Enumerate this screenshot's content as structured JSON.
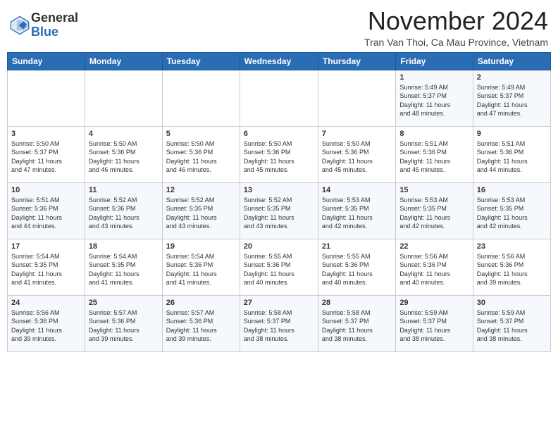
{
  "header": {
    "logo_line1": "General",
    "logo_line2": "Blue",
    "month": "November 2024",
    "location": "Tran Van Thoi, Ca Mau Province, Vietnam"
  },
  "weekdays": [
    "Sunday",
    "Monday",
    "Tuesday",
    "Wednesday",
    "Thursday",
    "Friday",
    "Saturday"
  ],
  "weeks": [
    [
      {
        "day": "",
        "info": ""
      },
      {
        "day": "",
        "info": ""
      },
      {
        "day": "",
        "info": ""
      },
      {
        "day": "",
        "info": ""
      },
      {
        "day": "",
        "info": ""
      },
      {
        "day": "1",
        "info": "Sunrise: 5:49 AM\nSunset: 5:37 PM\nDaylight: 11 hours\nand 48 minutes."
      },
      {
        "day": "2",
        "info": "Sunrise: 5:49 AM\nSunset: 5:37 PM\nDaylight: 11 hours\nand 47 minutes."
      }
    ],
    [
      {
        "day": "3",
        "info": "Sunrise: 5:50 AM\nSunset: 5:37 PM\nDaylight: 11 hours\nand 47 minutes."
      },
      {
        "day": "4",
        "info": "Sunrise: 5:50 AM\nSunset: 5:36 PM\nDaylight: 11 hours\nand 46 minutes."
      },
      {
        "day": "5",
        "info": "Sunrise: 5:50 AM\nSunset: 5:36 PM\nDaylight: 11 hours\nand 46 minutes."
      },
      {
        "day": "6",
        "info": "Sunrise: 5:50 AM\nSunset: 5:36 PM\nDaylight: 11 hours\nand 45 minutes."
      },
      {
        "day": "7",
        "info": "Sunrise: 5:50 AM\nSunset: 5:36 PM\nDaylight: 11 hours\nand 45 minutes."
      },
      {
        "day": "8",
        "info": "Sunrise: 5:51 AM\nSunset: 5:36 PM\nDaylight: 11 hours\nand 45 minutes."
      },
      {
        "day": "9",
        "info": "Sunrise: 5:51 AM\nSunset: 5:36 PM\nDaylight: 11 hours\nand 44 minutes."
      }
    ],
    [
      {
        "day": "10",
        "info": "Sunrise: 5:51 AM\nSunset: 5:36 PM\nDaylight: 11 hours\nand 44 minutes."
      },
      {
        "day": "11",
        "info": "Sunrise: 5:52 AM\nSunset: 5:36 PM\nDaylight: 11 hours\nand 43 minutes."
      },
      {
        "day": "12",
        "info": "Sunrise: 5:52 AM\nSunset: 5:35 PM\nDaylight: 11 hours\nand 43 minutes."
      },
      {
        "day": "13",
        "info": "Sunrise: 5:52 AM\nSunset: 5:35 PM\nDaylight: 11 hours\nand 43 minutes."
      },
      {
        "day": "14",
        "info": "Sunrise: 5:53 AM\nSunset: 5:35 PM\nDaylight: 11 hours\nand 42 minutes."
      },
      {
        "day": "15",
        "info": "Sunrise: 5:53 AM\nSunset: 5:35 PM\nDaylight: 11 hours\nand 42 minutes."
      },
      {
        "day": "16",
        "info": "Sunrise: 5:53 AM\nSunset: 5:35 PM\nDaylight: 11 hours\nand 42 minutes."
      }
    ],
    [
      {
        "day": "17",
        "info": "Sunrise: 5:54 AM\nSunset: 5:35 PM\nDaylight: 11 hours\nand 41 minutes."
      },
      {
        "day": "18",
        "info": "Sunrise: 5:54 AM\nSunset: 5:35 PM\nDaylight: 11 hours\nand 41 minutes."
      },
      {
        "day": "19",
        "info": "Sunrise: 5:54 AM\nSunset: 5:36 PM\nDaylight: 11 hours\nand 41 minutes."
      },
      {
        "day": "20",
        "info": "Sunrise: 5:55 AM\nSunset: 5:36 PM\nDaylight: 11 hours\nand 40 minutes."
      },
      {
        "day": "21",
        "info": "Sunrise: 5:55 AM\nSunset: 5:36 PM\nDaylight: 11 hours\nand 40 minutes."
      },
      {
        "day": "22",
        "info": "Sunrise: 5:56 AM\nSunset: 5:36 PM\nDaylight: 11 hours\nand 40 minutes."
      },
      {
        "day": "23",
        "info": "Sunrise: 5:56 AM\nSunset: 5:36 PM\nDaylight: 11 hours\nand 39 minutes."
      }
    ],
    [
      {
        "day": "24",
        "info": "Sunrise: 5:56 AM\nSunset: 5:36 PM\nDaylight: 11 hours\nand 39 minutes."
      },
      {
        "day": "25",
        "info": "Sunrise: 5:57 AM\nSunset: 5:36 PM\nDaylight: 11 hours\nand 39 minutes."
      },
      {
        "day": "26",
        "info": "Sunrise: 5:57 AM\nSunset: 5:36 PM\nDaylight: 11 hours\nand 39 minutes."
      },
      {
        "day": "27",
        "info": "Sunrise: 5:58 AM\nSunset: 5:37 PM\nDaylight: 11 hours\nand 38 minutes."
      },
      {
        "day": "28",
        "info": "Sunrise: 5:58 AM\nSunset: 5:37 PM\nDaylight: 11 hours\nand 38 minutes."
      },
      {
        "day": "29",
        "info": "Sunrise: 5:59 AM\nSunset: 5:37 PM\nDaylight: 11 hours\nand 38 minutes."
      },
      {
        "day": "30",
        "info": "Sunrise: 5:59 AM\nSunset: 5:37 PM\nDaylight: 11 hours\nand 38 minutes."
      }
    ]
  ]
}
